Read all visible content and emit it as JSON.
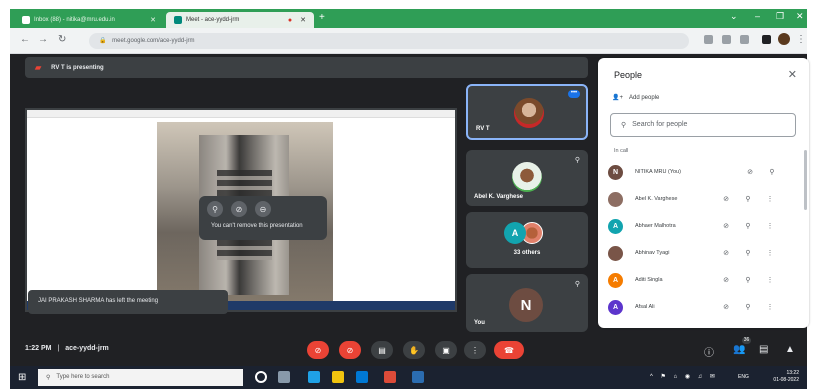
{
  "browser": {
    "tabs": [
      {
        "label": "Inbox (88) - nitika@mru.edu.in",
        "active": false
      },
      {
        "label": "Meet - ace-yydd-jrm",
        "active": true
      }
    ],
    "url": "meet.google.com/ace-yydd-jrm"
  },
  "presenting": {
    "text": "RV T is presenting"
  },
  "screen_share": {
    "tooltip": "You can't remove this presentation"
  },
  "toast": "JAI PRAKASH SHARMA has left the meeting",
  "tiles": [
    {
      "name": "RV T"
    },
    {
      "name": "Abel K. Varghese"
    },
    {
      "avatar_letter": "A",
      "count": "33 others"
    },
    {
      "name": "You",
      "avatar_letter": "N"
    }
  ],
  "people_panel": {
    "title": "People",
    "add_people": "Add people",
    "search_placeholder": "Search for people",
    "in_call": "In call",
    "participants": [
      {
        "name": "NITIKA MRU (You)",
        "letter": "N",
        "color": "#6d4c41"
      },
      {
        "name": "Abel K. Varghese",
        "letter": "",
        "color": "#8d6e63"
      },
      {
        "name": "Abhaer Malhotra",
        "letter": "A",
        "color": "#12a4af"
      },
      {
        "name": "Abhinav Tyagi",
        "letter": "",
        "color": "#795548"
      },
      {
        "name": "Aditi Singla",
        "letter": "A",
        "color": "#f57c00"
      },
      {
        "name": "Afsal Ali",
        "letter": "A",
        "color": "#5c35cc"
      }
    ]
  },
  "meeting_info": {
    "time": "1:22 PM",
    "separator": "|",
    "code": "ace-yydd-jrm"
  },
  "people_badge": "36",
  "taskbar": {
    "search_placeholder": "Type here to search",
    "language": "ENG",
    "time": "13:22",
    "date": "01-08-2022"
  },
  "colors": {
    "stage_bg": "#202124",
    "tile_bg": "#3c4043",
    "control_red": "#ea4335",
    "accent_blue": "#1a73e8",
    "chrome_green": "#2f9e56"
  }
}
